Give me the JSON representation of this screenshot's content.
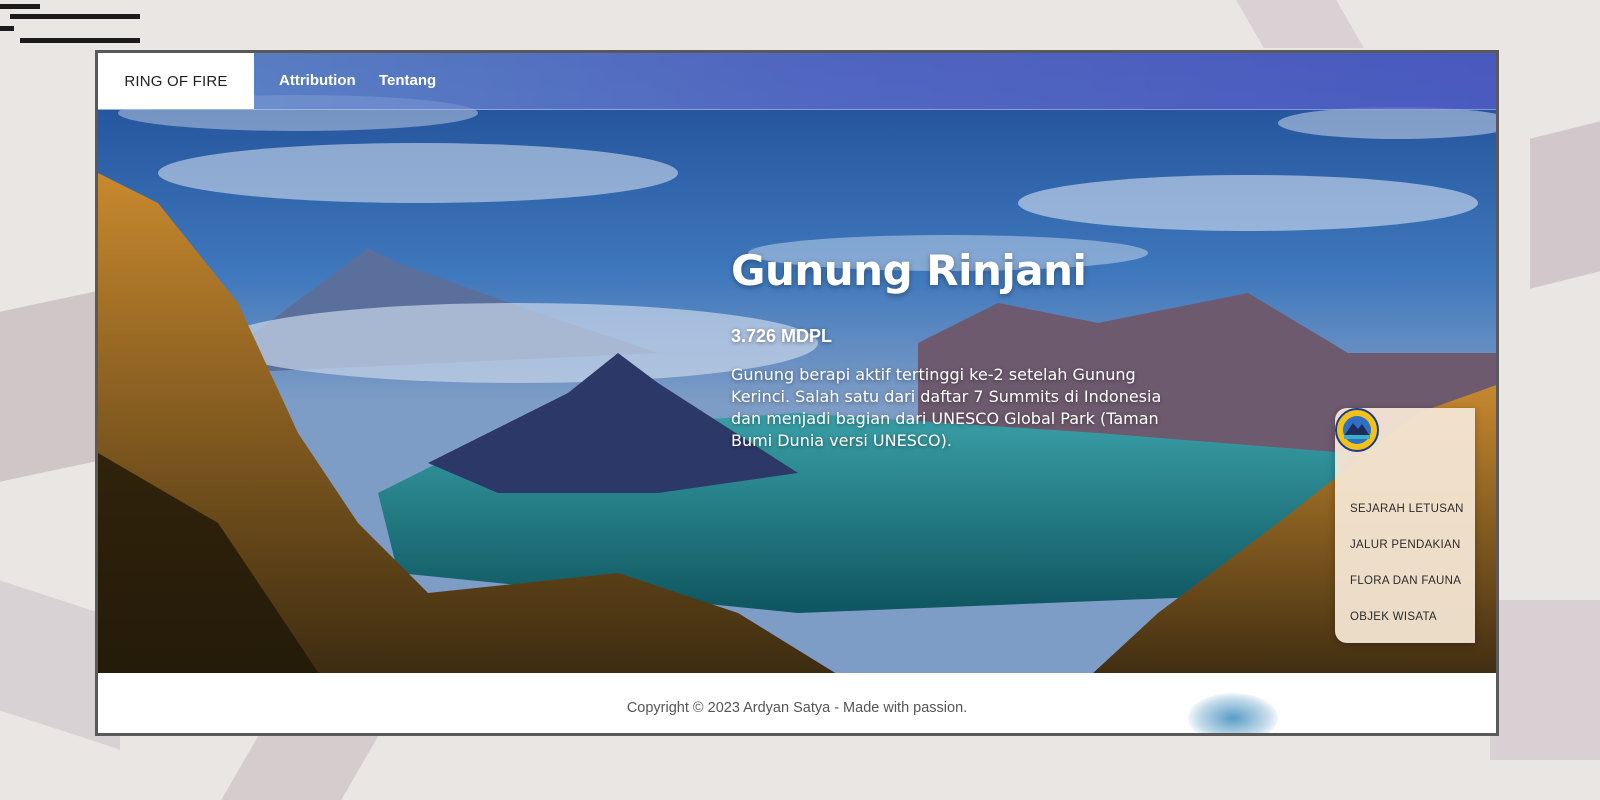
{
  "navbar": {
    "brand": "RING OF FIRE",
    "links": [
      "Attribution",
      "Tentang"
    ]
  },
  "hero": {
    "title": "Gunung Rinjani",
    "elevation": "3.726 MDPL",
    "description": "Gunung berapi aktif tertinggi ke-2 setelah Gunung Kerinci. Salah satu dari daftar 7 Summits di Indonesia dan menjadi bagian dari UNESCO Global Park (Taman Bumi Dunia versi UNESCO)."
  },
  "side_menu": {
    "logo_icon": "park-emblem-icon",
    "items": [
      "SEJARAH LETUSAN",
      "JALUR PENDAKIAN",
      "FLORA DAN FAUNA",
      "OBJEK WISATA"
    ]
  },
  "footer": {
    "copyright": "Copyright © 2023 Ardyan Satya - Made with passion."
  },
  "colors": {
    "navbar_accent": "#5f6cd0",
    "menu_bg": "#f6e8d6",
    "footer_text": "#555555"
  }
}
